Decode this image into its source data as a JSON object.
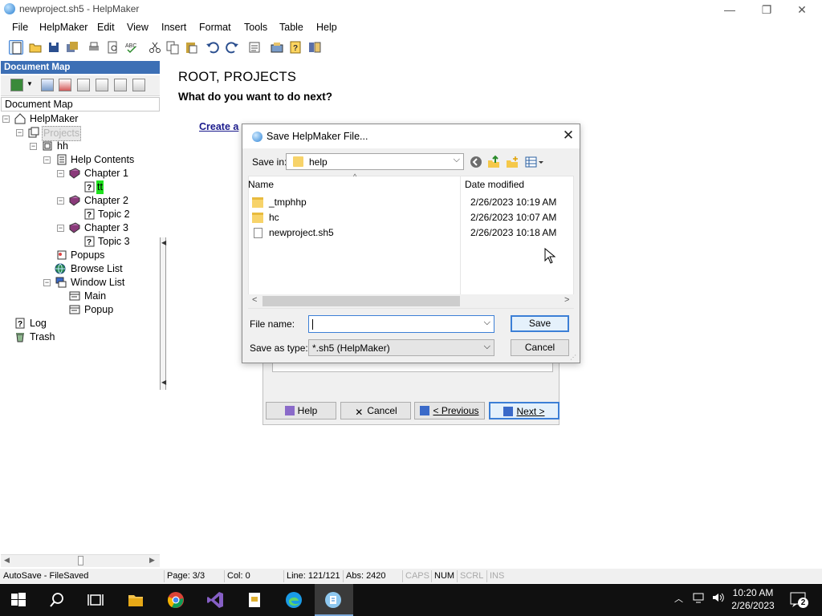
{
  "window": {
    "title": "newproject.sh5 - HelpMaker",
    "minimize": "—",
    "restore": "❐",
    "close": "✕"
  },
  "menu": [
    "File",
    "HelpMaker",
    "Edit",
    "View",
    "Insert",
    "Format",
    "Tools",
    "Table",
    "Help"
  ],
  "docmap": {
    "header": "Document Map",
    "label": "Document Map",
    "tree": {
      "root": "HelpMaker",
      "projects": "Projects",
      "hh": "hh",
      "help_contents": "Help Contents",
      "chapter1": "Chapter 1",
      "tt": "tt",
      "chapter2": "Chapter 2",
      "topic2": "Topic 2",
      "chapter3": "Chapter 3",
      "topic3": "Topic 3",
      "popups": "Popups",
      "browse_list": "Browse List",
      "window_list": "Window List",
      "main": "Main",
      "popup": "Popup",
      "log": "Log",
      "trash": "Trash"
    }
  },
  "main": {
    "title": "ROOT, PROJECTS",
    "question": "What do you want to do next?",
    "link": "Create a"
  },
  "wizard": {
    "help": "Help",
    "cancel": "Cancel",
    "previous": "< Previous",
    "next": "Next >"
  },
  "dialog": {
    "title": "Save HelpMaker File...",
    "save_in_label": "Save in:",
    "save_in_value": "help",
    "columns": {
      "name": "Name",
      "date": "Date modified"
    },
    "files": [
      {
        "name": "_tmphhp",
        "date": "2/26/2023 10:19 AM",
        "kind": "folder"
      },
      {
        "name": "hc",
        "date": "2/26/2023 10:07 AM",
        "kind": "folder"
      },
      {
        "name": "newproject.sh5",
        "date": "2/26/2023 10:18 AM",
        "kind": "file"
      }
    ],
    "file_name_label": "File name:",
    "file_name_value": "",
    "save_type_label": "Save as type:",
    "save_type_value": "*.sh5 (HelpMaker)",
    "save_button": "Save",
    "cancel_button": "Cancel"
  },
  "status": {
    "autosave": "AutoSave - FileSaved",
    "page": "Page: 3/3",
    "col": "Col: 0",
    "line": "Line: 121/121",
    "abs": "Abs: 2420",
    "caps": "CAPS",
    "num": "NUM",
    "scrl": "SCRL",
    "ins": "INS"
  },
  "taskbar": {
    "time": "10:20 AM",
    "date": "2/26/2023",
    "notifications": "2"
  },
  "colors": {
    "docmap_header": "#3c6fb5",
    "accent": "#3c7fd6",
    "taskbar": "#101010",
    "highlight_green": "#1fe21f"
  }
}
